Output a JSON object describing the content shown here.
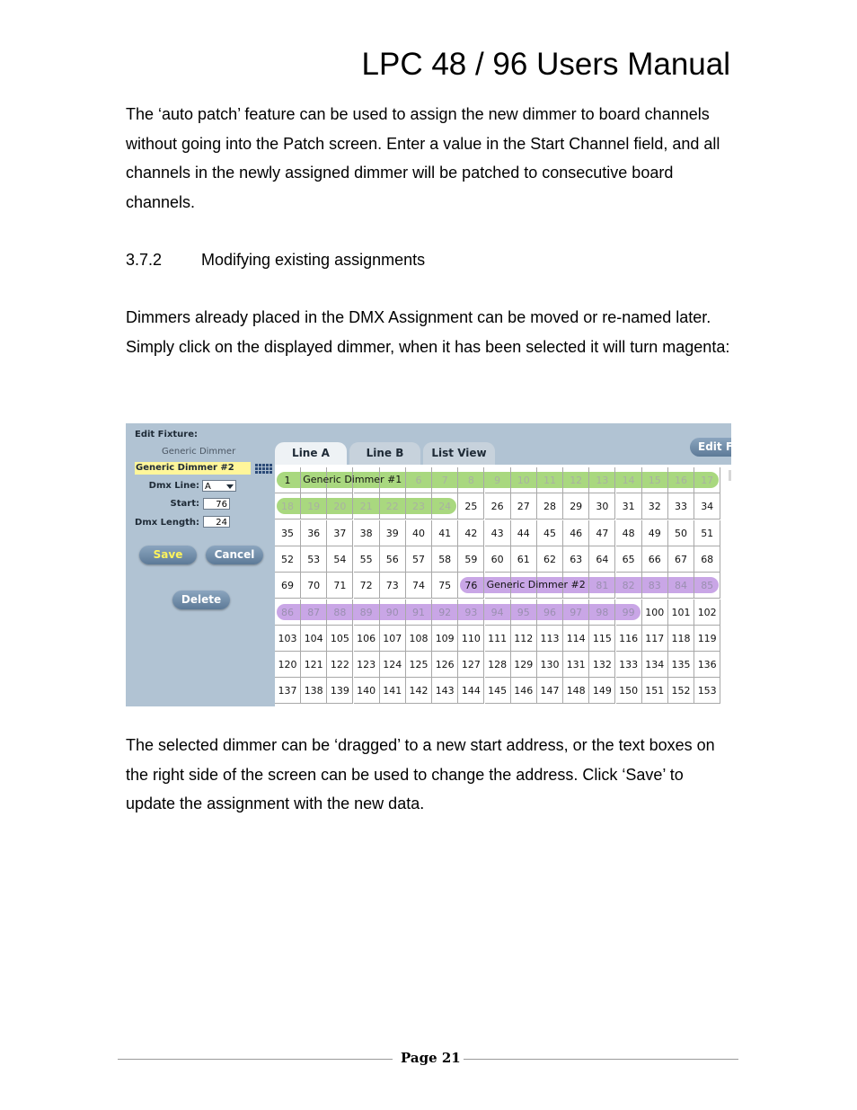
{
  "header": {
    "title": "LPC 48 / 96 Users Manual"
  },
  "body": {
    "para1": "The ‘auto patch’ feature can be used to assign the new dimmer to board channels without going into the Patch screen.  Enter a value in the Start Channel field, and all channels in the newly assigned dimmer will be patched to consecutive board channels.",
    "section_number": "3.7.2",
    "section_title": "Modifying existing assignments",
    "para2": "Dimmers already placed in the DMX Assignment can be moved or re-named later.  Simply click on the displayed dimmer, when it has been selected it will turn magenta:",
    "para3": "The selected dimmer can be ‘dragged’ to a new start address, or the text boxes on the right side of the screen can be used to change the address.  Click ‘Save’ to update the assignment with the new data."
  },
  "screenshot": {
    "edit_fixture_label": "Edit Fixture:",
    "fixture_type": "Generic Dimmer",
    "fixture_name": "Generic Dimmer #2",
    "dmx_line_label": "Dmx Line:",
    "dmx_line_value": "A",
    "start_label": "Start:",
    "start_value": "76",
    "dmx_length_label": "Dmx Length:",
    "dmx_length_value": "24",
    "save_label": "Save",
    "cancel_label": "Cancel",
    "delete_label": "Delete",
    "tabs": [
      "Line A",
      "Line B",
      "List View"
    ],
    "edit_fixture_button": "Edit Fix",
    "dimmer1_label": "Generic Dimmer #1",
    "dimmer2_label": "Generic Dimmer #2",
    "channel_start": 1,
    "channel_end": 153,
    "dimmer1_range": [
      1,
      24
    ],
    "dimmer2_range": [
      76,
      99
    ],
    "colors": {
      "dimmer1": "#a9d87f",
      "dimmer2": "#c9a6e6",
      "panel": "#b1c3d3"
    }
  },
  "footer": {
    "page": "Page 21"
  }
}
